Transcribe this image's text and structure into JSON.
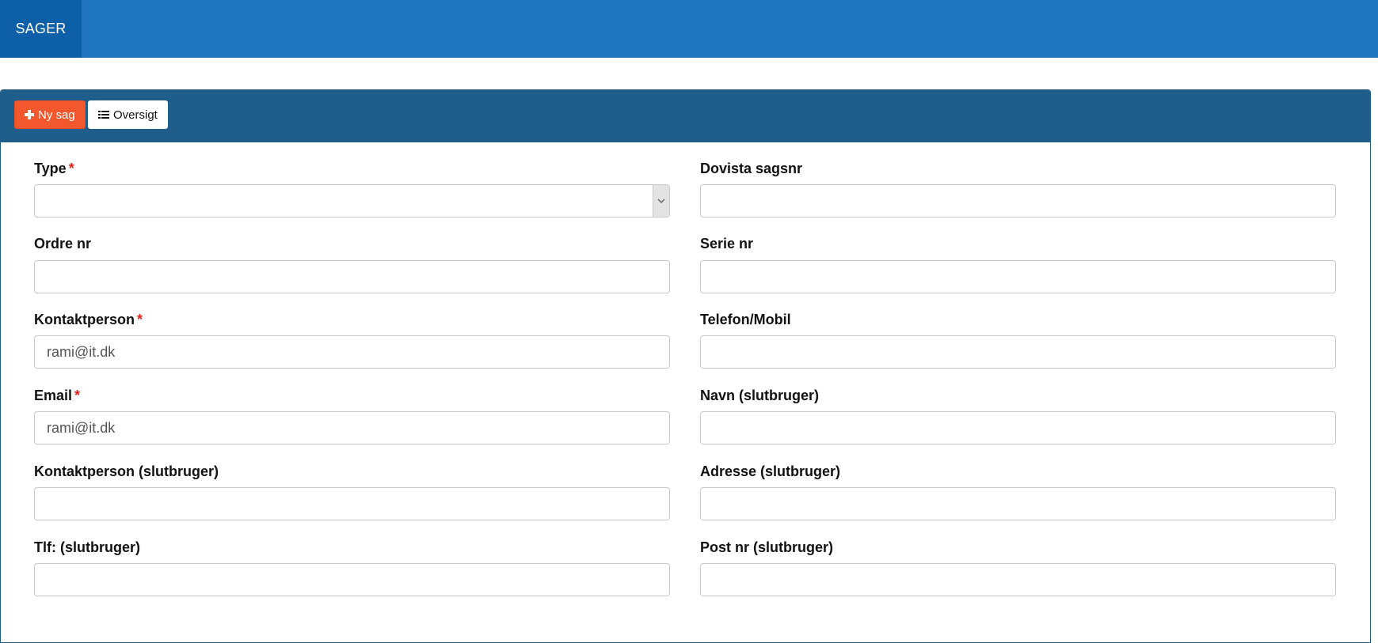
{
  "header": {
    "nav_label": "SAGER"
  },
  "toolbar": {
    "new_label": "Ny sag",
    "overview_label": "Oversigt"
  },
  "form": {
    "required_mark": "*",
    "left": [
      {
        "label": "Type",
        "required": true,
        "value": "",
        "kind": "select"
      },
      {
        "label": "Ordre nr",
        "required": false,
        "value": ""
      },
      {
        "label": "Kontaktperson",
        "required": true,
        "value": "rami@it.dk"
      },
      {
        "label": "Email",
        "required": true,
        "value": "rami@it.dk"
      },
      {
        "label": "Kontaktperson (slutbruger)",
        "required": false,
        "value": ""
      },
      {
        "label": "Tlf: (slutbruger)",
        "required": false,
        "value": ""
      }
    ],
    "right": [
      {
        "label": "Dovista sagsnr",
        "value": ""
      },
      {
        "label": "Serie nr",
        "value": ""
      },
      {
        "label": "Telefon/Mobil",
        "value": ""
      },
      {
        "label": "Navn (slutbruger)",
        "value": ""
      },
      {
        "label": "Adresse (slutbruger)",
        "value": ""
      },
      {
        "label": "Post nr (slutbruger)",
        "value": ""
      }
    ]
  }
}
